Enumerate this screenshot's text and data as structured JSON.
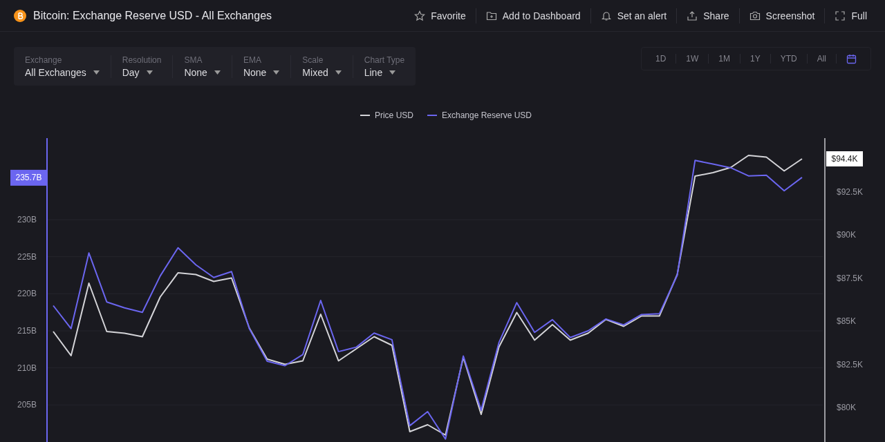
{
  "header": {
    "title": "Bitcoin: Exchange Reserve USD - All Exchanges",
    "actions": [
      {
        "kind": "star",
        "label": "Favorite"
      },
      {
        "kind": "folder",
        "label": "Add to Dashboard"
      },
      {
        "kind": "bell",
        "label": "Set an alert"
      },
      {
        "kind": "share",
        "label": "Share"
      },
      {
        "kind": "camera",
        "label": "Screenshot"
      },
      {
        "kind": "expand",
        "label": "Full"
      }
    ]
  },
  "filters": [
    {
      "label": "Exchange",
      "value": "All Exchanges"
    },
    {
      "label": "Resolution",
      "value": "Day"
    },
    {
      "label": "SMA",
      "value": "None"
    },
    {
      "label": "EMA",
      "value": "None"
    },
    {
      "label": "Scale",
      "value": "Mixed"
    },
    {
      "label": "Chart Type",
      "value": "Line"
    }
  ],
  "periods": [
    {
      "label": "1D",
      "selected": false
    },
    {
      "label": "1W",
      "selected": false
    },
    {
      "label": "1M",
      "selected": false
    },
    {
      "label": "1Y",
      "selected": false
    },
    {
      "label": "YTD",
      "selected": false
    },
    {
      "label": "All",
      "selected": false
    }
  ],
  "chart": {
    "chart_data": {
      "type": "line",
      "yticks": [
        {
          "value": 205,
          "label": "205B"
        },
        {
          "value": 210,
          "label": "210B"
        },
        {
          "value": 215,
          "label": "215B"
        },
        {
          "value": 220,
          "label": "220B"
        },
        {
          "value": 225,
          "label": "225B"
        },
        {
          "value": 230,
          "label": "230B"
        }
      ],
      "grid": true,
      "ylim": [
        200,
        241
      ],
      "y2ticks": [
        {
          "value": 80,
          "label": "$80K"
        },
        {
          "value": 82.5,
          "label": "$82.5K"
        },
        {
          "value": 85,
          "label": "$85K"
        },
        {
          "value": 87.5,
          "label": "$87.5K"
        },
        {
          "value": 90,
          "label": "$90K"
        },
        {
          "value": 92.5,
          "label": "$92.5K"
        }
      ],
      "y2lim": [
        78,
        95.6
      ],
      "series": [
        {
          "name": "Price USD",
          "color": "#d4d4d8",
          "axis": "y2",
          "values": [
            84.4,
            83.0,
            87.2,
            84.4,
            84.3,
            84.1,
            86.4,
            87.8,
            87.7,
            87.3,
            87.5,
            84.6,
            82.8,
            82.5,
            82.7,
            85.4,
            82.7,
            83.4,
            84.1,
            83.6,
            78.6,
            79.0,
            78.4,
            82.9,
            79.6,
            83.5,
            85.5,
            83.9,
            84.8,
            83.9,
            84.3,
            85.1,
            84.7,
            85.3,
            85.3,
            87.7,
            93.4,
            93.6,
            93.9,
            94.6,
            94.5,
            93.7,
            94.4
          ]
        },
        {
          "name": "Exchange Reserve USD",
          "color": "#6b66f0",
          "axis": "y",
          "values": [
            218.4,
            215.3,
            225.5,
            218.9,
            218.1,
            217.5,
            222.4,
            226.2,
            223.9,
            222.2,
            223.0,
            215.3,
            210.9,
            210.3,
            211.8,
            219.1,
            212.2,
            212.8,
            214.7,
            213.8,
            202.2,
            204.1,
            200.4,
            211.6,
            204.3,
            213.4,
            218.8,
            214.8,
            216.5,
            214.1,
            215.0,
            216.6,
            215.8,
            217.2,
            217.3,
            222.5,
            238.0,
            237.5,
            237.0,
            235.9,
            236.0,
            233.9,
            235.7
          ]
        }
      ]
    },
    "badges": [
      {
        "kind": "left",
        "text": "235.7B"
      },
      {
        "kind": "right",
        "text": "$94.4K"
      }
    ]
  }
}
